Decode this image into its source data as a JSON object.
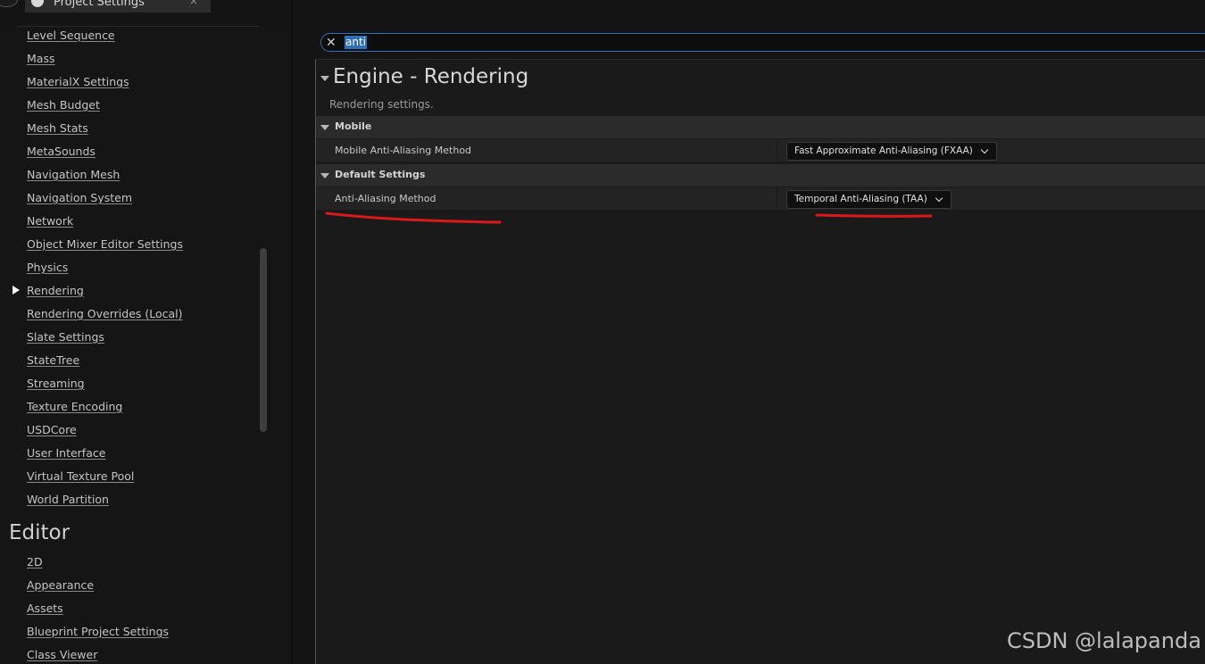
{
  "window": {
    "tab_title": "Project Settings",
    "close_glyph": "×"
  },
  "sidebar": {
    "items_top": [
      {
        "label": "Level Sequence"
      },
      {
        "label": "Mass"
      },
      {
        "label": "MaterialX Settings"
      },
      {
        "label": "Mesh Budget"
      },
      {
        "label": "Mesh Stats"
      },
      {
        "label": "MetaSounds"
      },
      {
        "label": "Navigation Mesh"
      },
      {
        "label": "Navigation System"
      },
      {
        "label": "Network"
      },
      {
        "label": "Object Mixer Editor Settings"
      },
      {
        "label": "Physics"
      },
      {
        "label": "Rendering",
        "selected": true
      },
      {
        "label": "Rendering Overrides (Local)"
      },
      {
        "label": "Slate Settings"
      },
      {
        "label": "StateTree"
      },
      {
        "label": "Streaming"
      },
      {
        "label": "Texture Encoding"
      },
      {
        "label": "USDCore"
      },
      {
        "label": "User Interface"
      },
      {
        "label": "Virtual Texture Pool"
      },
      {
        "label": "World Partition"
      }
    ],
    "editor_heading": "Editor",
    "items_editor": [
      {
        "label": "2D"
      },
      {
        "label": "Appearance"
      },
      {
        "label": "Assets"
      },
      {
        "label": "Blueprint Project Settings"
      },
      {
        "label": "Class Viewer"
      }
    ]
  },
  "search": {
    "query": "anti",
    "clear_glyph": "✕"
  },
  "details": {
    "category_title": "Engine - Rendering",
    "category_description": "Rendering settings.",
    "groups": [
      {
        "label": "Mobile",
        "property": {
          "label": "Mobile Anti-Aliasing Method",
          "value": "Fast Approximate Anti-Aliasing (FXAA)"
        }
      },
      {
        "label": "Default Settings",
        "property": {
          "label": "Anti-Aliasing Method",
          "value": "Temporal Anti-Aliasing (TAA)"
        }
      }
    ]
  },
  "annotation_color": "#d9191c",
  "accent_color": "#2f6fb5",
  "watermark": "CSDN @lalapanda"
}
